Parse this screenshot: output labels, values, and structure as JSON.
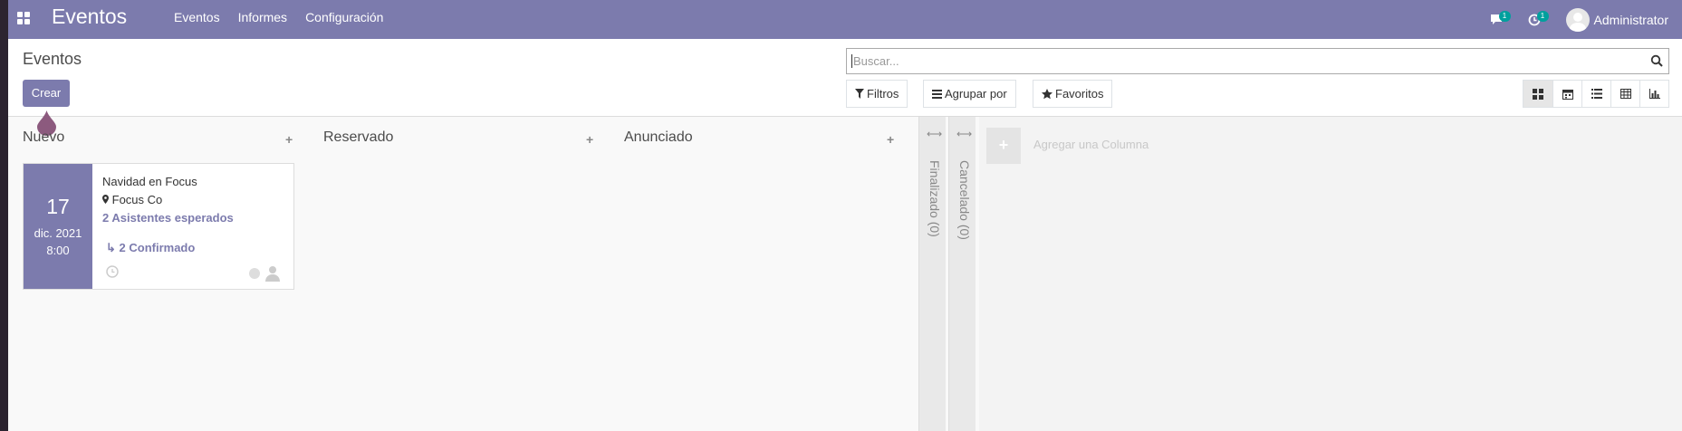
{
  "navbar": {
    "brand": "Eventos",
    "menu": [
      "Eventos",
      "Informes",
      "Configuración"
    ],
    "messages_badge": "1",
    "activities_badge": "1",
    "user": "Administrator"
  },
  "control": {
    "breadcrumb": "Eventos",
    "create_label": "Crear",
    "search_placeholder": "Buscar...",
    "filters_label": "Filtros",
    "groupby_label": "Agrupar por",
    "favorites_label": "Favoritos",
    "views": [
      "kanban-view-icon",
      "calendar-view-icon",
      "list-view-icon",
      "pivot-view-icon",
      "graph-view-icon"
    ]
  },
  "kanban": {
    "columns": [
      {
        "title": "Nuevo"
      },
      {
        "title": "Reservado"
      },
      {
        "title": "Anunciado"
      }
    ],
    "folded": [
      {
        "label": "Finalizado (0)"
      },
      {
        "label": "Cancelado (0)"
      }
    ],
    "add_column_label": "Agregar una Columna",
    "card": {
      "day": "17",
      "month": "dic. 2021",
      "time": "8:00",
      "name": "Navidad en Focus",
      "location": "Focus Co",
      "expected": "2 Asistentes esperados",
      "confirmed": "2 Confirmado"
    }
  },
  "colors": {
    "brand": "#7c7bad",
    "badge": "#00a09d"
  }
}
